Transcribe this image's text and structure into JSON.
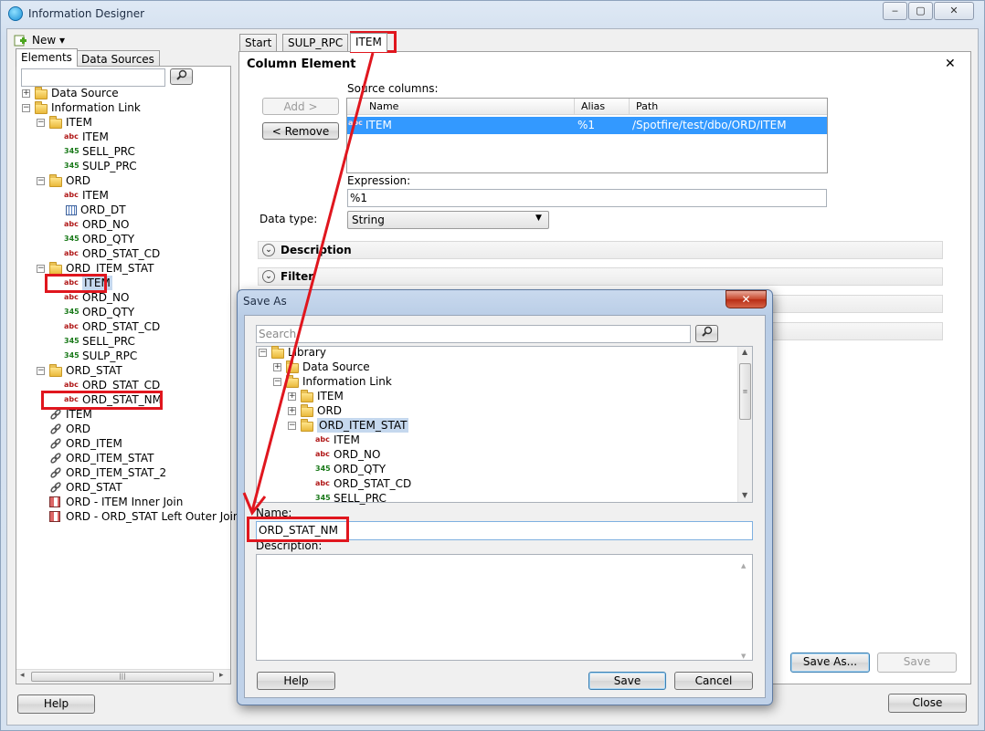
{
  "window": {
    "title": "Information Designer",
    "caption_buttons": [
      "‒",
      "▢",
      "✕"
    ]
  },
  "left_panel": {
    "new_label": "New ▾",
    "tabs": [
      "Elements",
      "Data Sources"
    ],
    "tree": [
      {
        "label": "Data Source",
        "icon": "folder",
        "level": 0,
        "exp": "+"
      },
      {
        "label": "Information Link",
        "icon": "folder",
        "level": 0,
        "exp": "−"
      },
      {
        "label": "ITEM",
        "icon": "folder",
        "level": 1,
        "exp": "−"
      },
      {
        "label": "ITEM",
        "icon": "abc",
        "level": 2
      },
      {
        "label": "SELL_PRC",
        "icon": "345",
        "level": 2
      },
      {
        "label": "SULP_PRC",
        "icon": "345",
        "level": 2
      },
      {
        "label": "ORD",
        "icon": "folder",
        "level": 1,
        "exp": "−"
      },
      {
        "label": "ITEM",
        "icon": "abc",
        "level": 2
      },
      {
        "label": "ORD_DT",
        "icon": "date",
        "level": 2
      },
      {
        "label": "ORD_NO",
        "icon": "abc",
        "level": 2
      },
      {
        "label": "ORD_QTY",
        "icon": "345",
        "level": 2
      },
      {
        "label": "ORD_STAT_CD",
        "icon": "abc",
        "level": 2
      },
      {
        "label": "ORD_ITEM_STAT",
        "icon": "folder",
        "level": 1,
        "exp": "−"
      },
      {
        "label": "ITEM",
        "icon": "abc",
        "level": 2,
        "selected": true
      },
      {
        "label": "ORD_NO",
        "icon": "abc",
        "level": 2
      },
      {
        "label": "ORD_QTY",
        "icon": "345",
        "level": 2
      },
      {
        "label": "ORD_STAT_CD",
        "icon": "abc",
        "level": 2
      },
      {
        "label": "SELL_PRC",
        "icon": "345",
        "level": 2
      },
      {
        "label": "SULP_RPC",
        "icon": "345",
        "level": 2
      },
      {
        "label": "ORD_STAT",
        "icon": "folder",
        "level": 1,
        "exp": "−"
      },
      {
        "label": "ORD_STAT_CD",
        "icon": "abc",
        "level": 2
      },
      {
        "label": "ORD_STAT_NM",
        "icon": "abc",
        "level": 2
      },
      {
        "label": "ITEM",
        "icon": "link",
        "level": 1
      },
      {
        "label": "ORD",
        "icon": "link",
        "level": 1
      },
      {
        "label": "ORD_ITEM",
        "icon": "link",
        "level": 1
      },
      {
        "label": "ORD_ITEM_STAT",
        "icon": "link",
        "level": 1
      },
      {
        "label": "ORD_ITEM_STAT_2",
        "icon": "link",
        "level": 1
      },
      {
        "label": "ORD_STAT",
        "icon": "link",
        "level": 1
      },
      {
        "label": "ORD - ITEM  Inner Join",
        "icon": "join",
        "level": 1
      },
      {
        "label": "ORD - ORD_STAT  Left Outer Join",
        "icon": "join",
        "level": 1
      }
    ],
    "help_label": "Help"
  },
  "editor": {
    "tabs": [
      "Start",
      "SULP_RPC",
      "ITEM"
    ],
    "heading": "Column Element",
    "close_glyph": "✕",
    "add_label": "Add >",
    "remove_label": "< Remove",
    "source_columns_label": "Source columns:",
    "table_headers": [
      "Name",
      "Alias",
      "Path"
    ],
    "table_row": {
      "icon": "abc",
      "name": "ITEM",
      "alias": "%1",
      "path": "/Spotfire/test/dbo/ORD/ITEM"
    },
    "expression_label": "Expression:",
    "expression_value": "%1",
    "data_type_label": "Data type:",
    "data_type_value": "String",
    "sections": [
      "Description",
      "Filter"
    ],
    "save_as_label": "Save As...",
    "save_label": "Save",
    "close_label": "Close"
  },
  "dialog": {
    "title": "Save As",
    "close_glyph": "✕",
    "search_placeholder": "Search",
    "tree": [
      {
        "label": "Library",
        "icon": "folder",
        "level": 0,
        "exp": "−"
      },
      {
        "label": "Data Source",
        "icon": "folder",
        "level": 1,
        "exp": "+"
      },
      {
        "label": "Information Link",
        "icon": "folder",
        "level": 1,
        "exp": "−"
      },
      {
        "label": "ITEM",
        "icon": "folder",
        "level": 2,
        "exp": "+"
      },
      {
        "label": "ORD",
        "icon": "folder",
        "level": 2,
        "exp": "+"
      },
      {
        "label": "ORD_ITEM_STAT",
        "icon": "folder",
        "level": 2,
        "exp": "−",
        "selected": true
      },
      {
        "label": "ITEM",
        "icon": "abc",
        "level": 3
      },
      {
        "label": "ORD_NO",
        "icon": "abc",
        "level": 3
      },
      {
        "label": "ORD_QTY",
        "icon": "345",
        "level": 3
      },
      {
        "label": "ORD_STAT_CD",
        "icon": "abc",
        "level": 3
      },
      {
        "label": "SELL_PRC",
        "icon": "345",
        "level": 3
      }
    ],
    "name_label": "Name:",
    "name_value": "ORD_STAT_NM",
    "description_label": "Description:",
    "help_label": "Help",
    "save_label": "Save",
    "cancel_label": "Cancel"
  },
  "colors": {
    "annotation": "#e0161e",
    "selection": "#3399ff",
    "tree_selection": "#c5d8ee"
  }
}
